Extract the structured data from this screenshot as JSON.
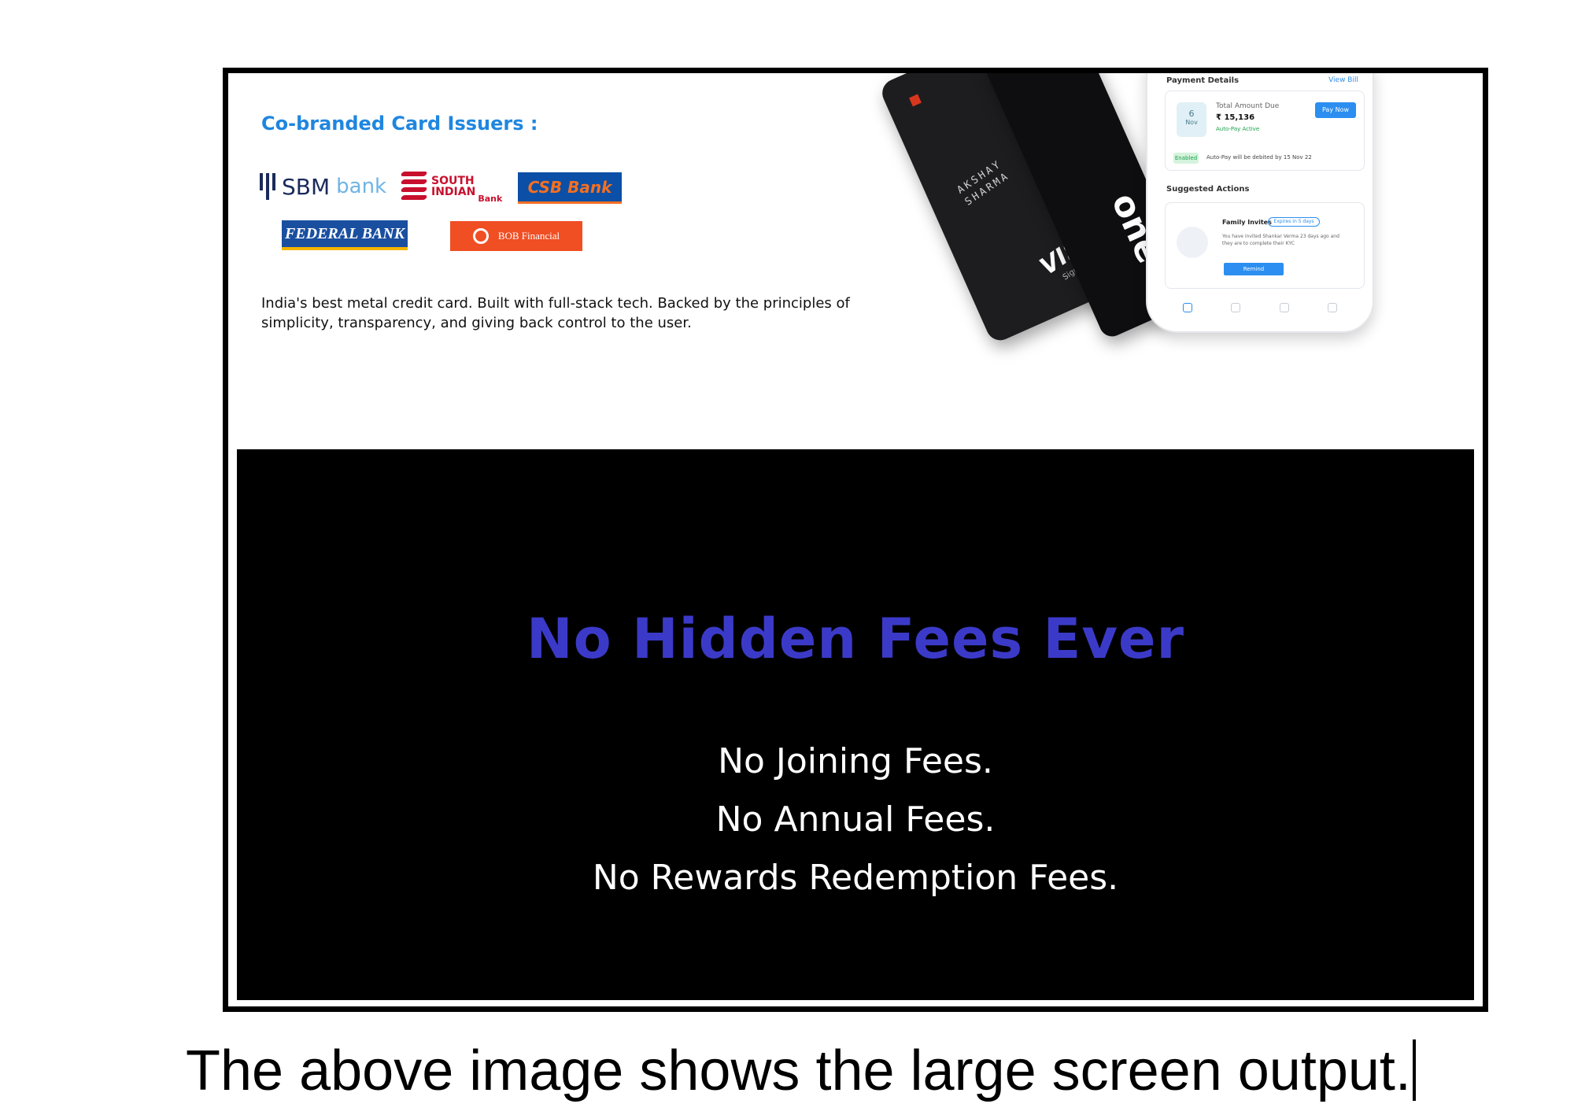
{
  "issuers": {
    "title": "Co-branded Card Issuers :",
    "logos": {
      "sbm": "SBM",
      "sbm_bank": "bank",
      "south_indian_line1": "SOUTH",
      "south_indian_line2": "INDIAN",
      "south_indian_bank": "Bank",
      "csb": "CSB Bank",
      "federal": "FEDERAL BANK",
      "bob": "BOB Financial"
    }
  },
  "tagline": "India's best metal credit card. Built with full-stack tech. Backed by the principles of simplicity, transparency, and giving back control to the user.",
  "card": {
    "name_line1": "AKSHAY",
    "name_line2": "SHARMA",
    "network": "VISA",
    "tier": "Signature",
    "brand": "one"
  },
  "phone": {
    "header": "Payment Details",
    "link": "View Bill",
    "date_day": "6",
    "date_month": "Nov",
    "due_label": "Total Amount Due",
    "due_value": "₹ 15,136",
    "autopay": "Auto-Pay Active",
    "pay_button": "Pay Now",
    "pill": "Enabled",
    "autopay_note": "Auto-Pay will be debited by 15 Nov 22",
    "suggested": "Suggested Actions",
    "invite_title": "Family Invites",
    "invite_badge": "Expires in 5 days",
    "invite_text": "You have invited Shankar Verma 23 days ago and they are to complete their KYC",
    "remind_button": "Remind"
  },
  "promo": {
    "headline": "No Hidden Fees Ever",
    "fees": [
      "No Joining Fees.",
      "No Annual Fees.",
      "No Rewards Redemption Fees."
    ]
  },
  "caption": "The above image shows the large screen output.",
  "colors": {
    "accent_blue": "#1f86e0",
    "headline_blue": "#3b3ac8",
    "dark_bg": "#000000"
  }
}
